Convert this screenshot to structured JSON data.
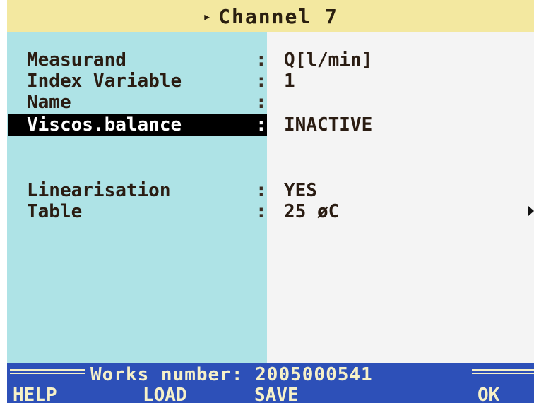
{
  "title": {
    "marker": "▸",
    "text": "Channel 7"
  },
  "fields": [
    {
      "label": "Measurand",
      "colon": ":",
      "value": "Q[l/min]"
    },
    {
      "label": "Index Variable",
      "colon": ":",
      "value": "1"
    },
    {
      "label": "Name",
      "colon": ":",
      "value": ""
    },
    {
      "label": "Viscos.balance",
      "colon": ":",
      "value": "INACTIVE"
    },
    {
      "label": "Linearisation",
      "colon": ":",
      "value": "YES"
    },
    {
      "label": "Table",
      "colon": ":",
      "value": "25 øC"
    }
  ],
  "works": {
    "text": "Works number: 2005000541"
  },
  "softkeys": {
    "help": "HELP",
    "load": "LOAD",
    "save": "SAVE",
    "ok": "OK"
  },
  "colors": {
    "title_bg": "#f3e8a0",
    "label_panel_bg": "#aee3e6",
    "value_panel_bg": "#f4f4f4",
    "status_bar_bg": "#2d50b8",
    "selection_bg": "#000000"
  },
  "icons": {
    "more_indicator": "right-triangle-icon",
    "title_marker": "title-marker-icon"
  }
}
